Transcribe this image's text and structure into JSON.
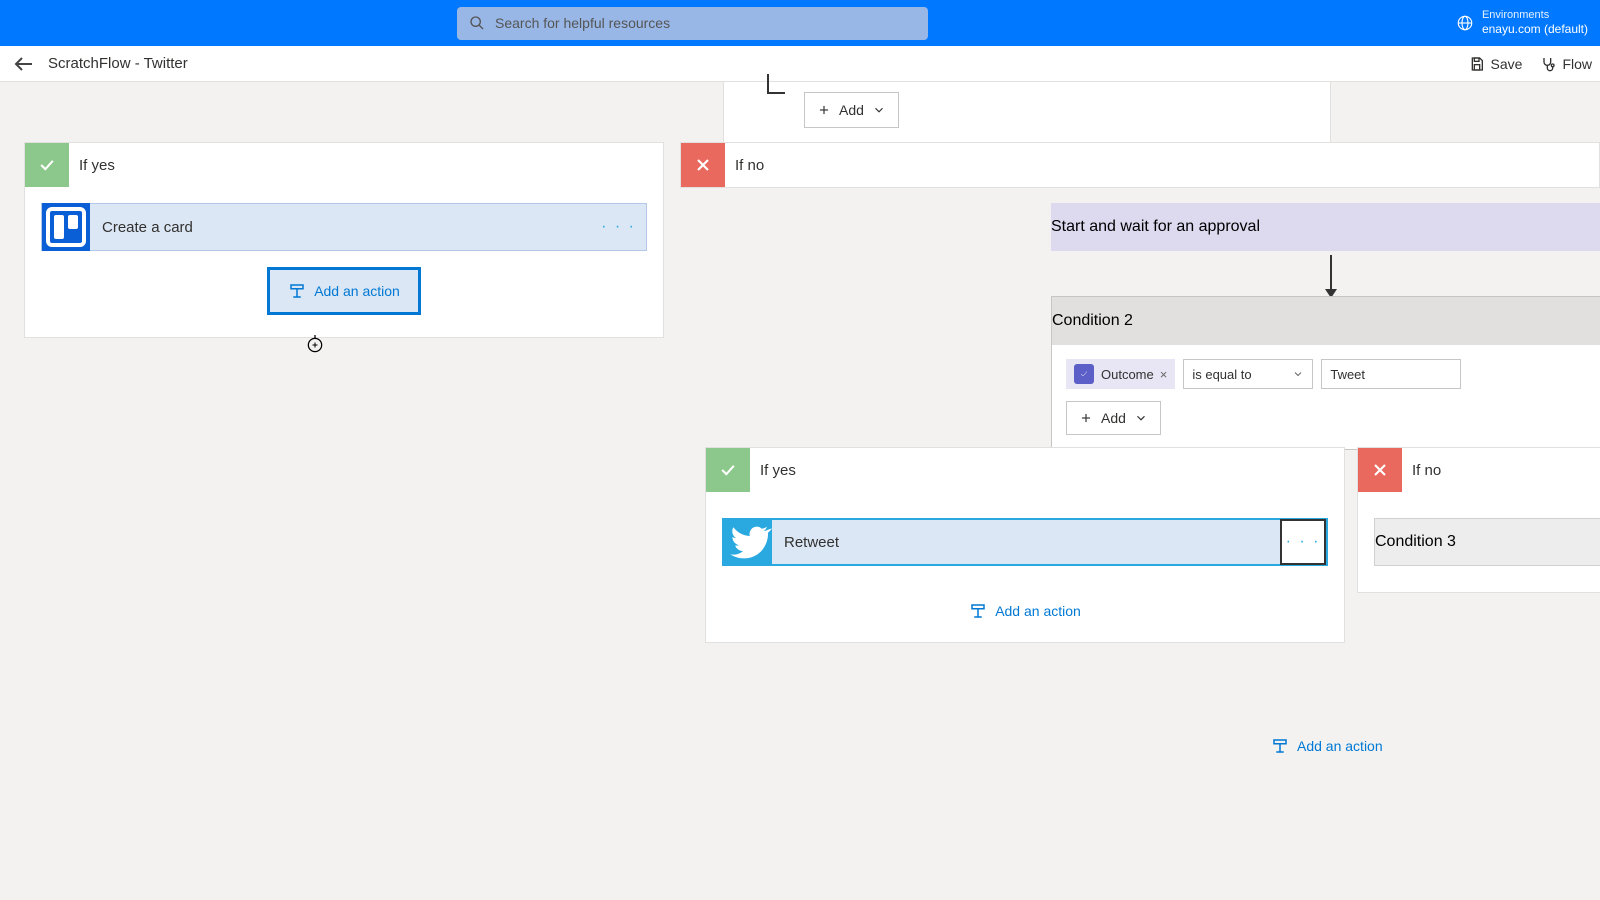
{
  "topbar": {
    "search_placeholder": "Search for helpful resources",
    "env_label": "Environments",
    "env_name": "enayu.com (default)"
  },
  "subbar": {
    "title": "ScratchFlow - Twitter",
    "save": "Save",
    "flow": "Flow"
  },
  "condTop": {
    "add": "Add"
  },
  "branchYes": {
    "title": "If yes",
    "create_card": "Create a card",
    "add_action": "Add an action"
  },
  "branchNo": {
    "title": "If no",
    "approval": "Start and wait for an approval",
    "condition2": "Condition 2",
    "outcome_token": "Outcome",
    "operator": "is equal to",
    "value": "Tweet",
    "add": "Add",
    "nestedYes": {
      "title": "If yes",
      "retweet": "Retweet",
      "add_action": "Add an action"
    },
    "nestedNo": {
      "title": "If no",
      "condition3": "Condition 3"
    },
    "bottom_add": "Add an action"
  }
}
